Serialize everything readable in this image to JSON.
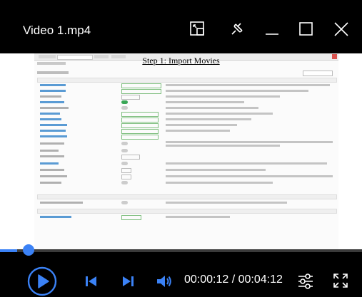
{
  "window": {
    "title": "Video 1.mp4"
  },
  "video": {
    "caption": "Step 1: Import Movies"
  },
  "player": {
    "progress": 0.047,
    "current_time": "00:00:12",
    "separator": " / ",
    "total_time": "00:04:12"
  },
  "colors": {
    "accent": "#3b82f6",
    "background": "#000000"
  }
}
